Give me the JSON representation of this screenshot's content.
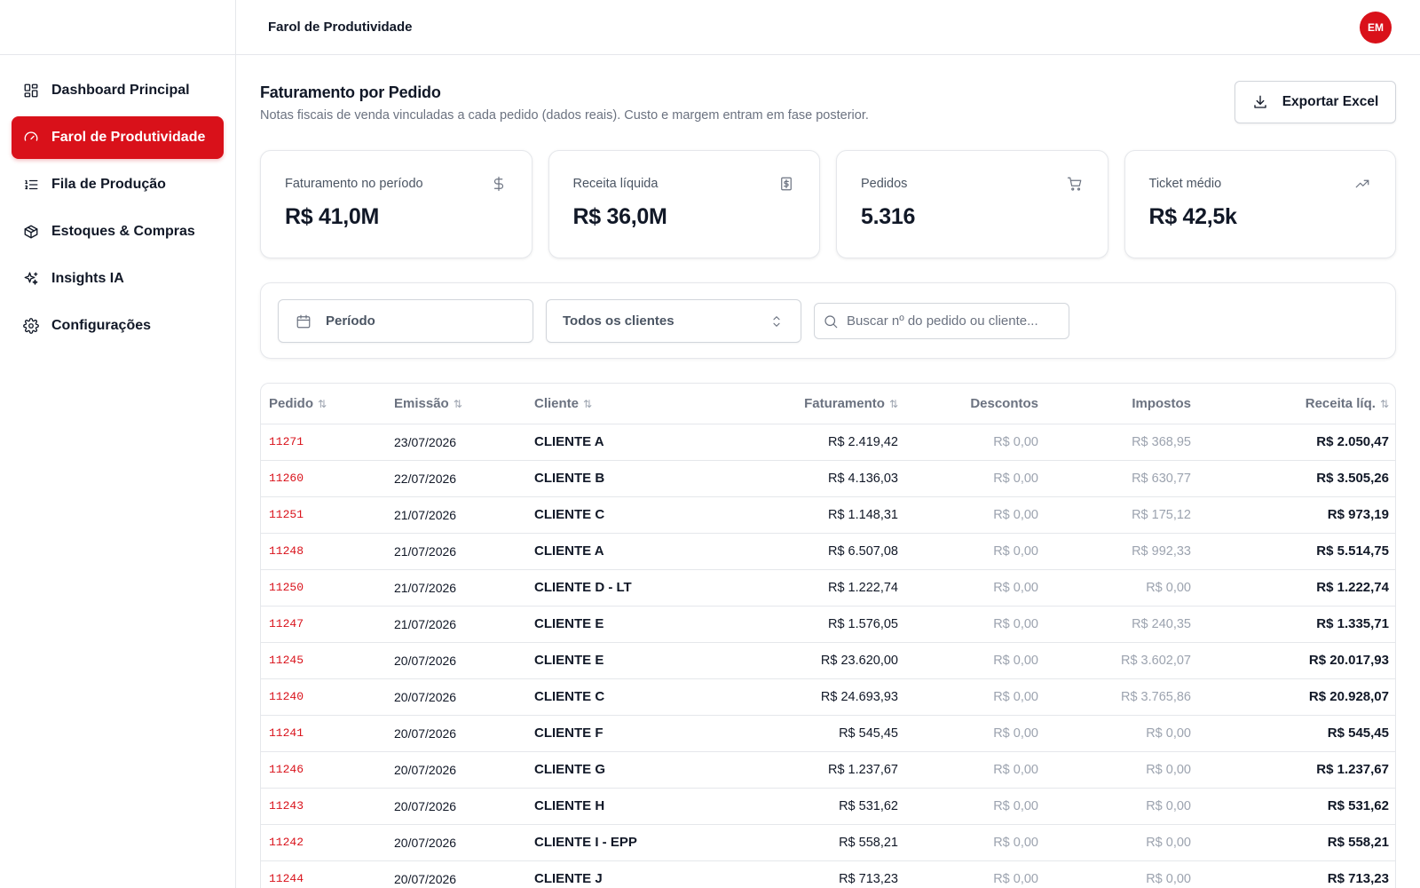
{
  "header": {
    "title": "Farol de Produtividade",
    "avatar": "EM"
  },
  "sidebar": {
    "items": [
      {
        "label": "Dashboard Principal",
        "icon": "dashboard-icon",
        "active": false
      },
      {
        "label": "Farol de Produtividade",
        "icon": "gauge-icon",
        "active": true
      },
      {
        "label": "Fila de Produção",
        "icon": "list-icon",
        "active": false
      },
      {
        "label": "Estoques & Compras",
        "icon": "box-icon",
        "active": false
      },
      {
        "label": "Insights IA",
        "icon": "sparkles-icon",
        "active": false
      },
      {
        "label": "Configurações",
        "icon": "gear-icon",
        "active": false
      }
    ]
  },
  "page": {
    "title": "Faturamento por Pedido",
    "subtitle": "Notas fiscais de venda vinculadas a cada pedido (dados reais). Custo e margem entram em fase posterior.",
    "export_label": "Exportar Excel"
  },
  "kpis": [
    {
      "label": "Faturamento no período",
      "value": "R$ 41,0M",
      "icon": "dollar-icon"
    },
    {
      "label": "Receita líquida",
      "value": "R$ 36,0M",
      "icon": "receipt-icon"
    },
    {
      "label": "Pedidos",
      "value": "5.316",
      "icon": "cart-icon"
    },
    {
      "label": "Ticket médio",
      "value": "R$ 42,5k",
      "icon": "trending-up-icon"
    }
  ],
  "filters": {
    "period_label": "Período",
    "client_select": "Todos os clientes",
    "search_placeholder": "Buscar nº do pedido ou cliente..."
  },
  "table": {
    "columns": [
      "Pedido",
      "Emissão",
      "Cliente",
      "Faturamento",
      "Descontos",
      "Impostos",
      "Receita líq."
    ],
    "rows": [
      [
        "11271",
        "23/07/2026",
        "CLIENTE A",
        "R$ 2.419,42",
        "R$ 0,00",
        "R$ 368,95",
        "R$ 2.050,47"
      ],
      [
        "11260",
        "22/07/2026",
        "CLIENTE B",
        "R$ 4.136,03",
        "R$ 0,00",
        "R$ 630,77",
        "R$ 3.505,26"
      ],
      [
        "11251",
        "21/07/2026",
        "CLIENTE C",
        "R$ 1.148,31",
        "R$ 0,00",
        "R$ 175,12",
        "R$ 973,19"
      ],
      [
        "11248",
        "21/07/2026",
        "CLIENTE A",
        "R$ 6.507,08",
        "R$ 0,00",
        "R$ 992,33",
        "R$ 5.514,75"
      ],
      [
        "11250",
        "21/07/2026",
        "CLIENTE D - LT",
        "R$ 1.222,74",
        "R$ 0,00",
        "R$ 0,00",
        "R$ 1.222,74"
      ],
      [
        "11247",
        "21/07/2026",
        "CLIENTE E",
        "R$ 1.576,05",
        "R$ 0,00",
        "R$ 240,35",
        "R$ 1.335,71"
      ],
      [
        "11245",
        "20/07/2026",
        "CLIENTE E",
        "R$ 23.620,00",
        "R$ 0,00",
        "R$ 3.602,07",
        "R$ 20.017,93"
      ],
      [
        "11240",
        "20/07/2026",
        "CLIENTE C",
        "R$ 24.693,93",
        "R$ 0,00",
        "R$ 3.765,86",
        "R$ 20.928,07"
      ],
      [
        "11241",
        "20/07/2026",
        "CLIENTE F",
        "R$ 545,45",
        "R$ 0,00",
        "R$ 0,00",
        "R$ 545,45"
      ],
      [
        "11246",
        "20/07/2026",
        "CLIENTE G",
        "R$ 1.237,67",
        "R$ 0,00",
        "R$ 0,00",
        "R$ 1.237,67"
      ],
      [
        "11243",
        "20/07/2026",
        "CLIENTE H",
        "R$ 531,62",
        "R$ 0,00",
        "R$ 0,00",
        "R$ 531,62"
      ],
      [
        "11242",
        "20/07/2026",
        "CLIENTE I - EPP",
        "R$ 558,21",
        "R$ 0,00",
        "R$ 0,00",
        "R$ 558,21"
      ],
      [
        "11244",
        "20/07/2026",
        "CLIENTE J",
        "R$ 713,23",
        "R$ 0,00",
        "R$ 0,00",
        "R$ 713,23"
      ]
    ]
  },
  "colors": {
    "accent": "#d9111a",
    "muted": "#6b7280",
    "border": "#e5e7eb"
  }
}
